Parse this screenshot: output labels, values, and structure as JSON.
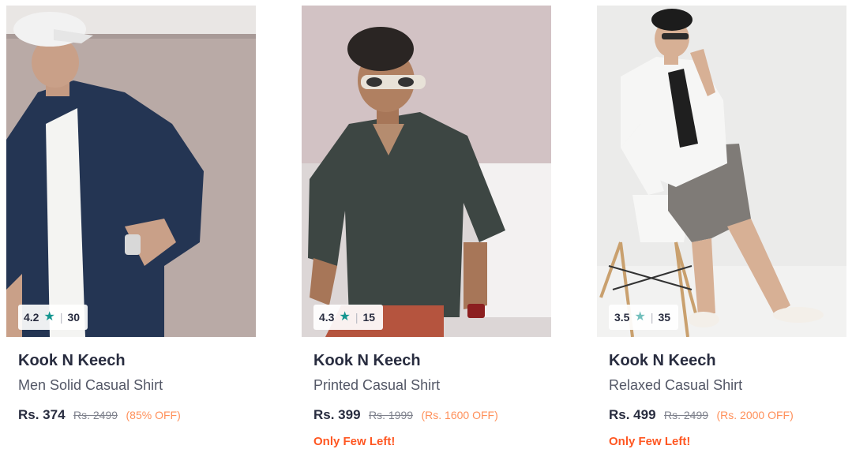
{
  "products": [
    {
      "rating": "4.2",
      "rating_count": "30",
      "brand": "Kook N Keech",
      "name": "Men Solid Casual Shirt",
      "price": "Rs. 374",
      "mrp": "Rs. 2499",
      "discount": "(85% OFF)",
      "stock_note": "",
      "image_desc_icon": "model-photo-navy-shirt"
    },
    {
      "rating": "4.3",
      "rating_count": "15",
      "brand": "Kook N Keech",
      "name": "Printed Casual Shirt",
      "price": "Rs. 399",
      "mrp": "Rs. 1999",
      "discount": "(Rs. 1600 OFF)",
      "stock_note": "Only Few Left!",
      "image_desc_icon": "model-photo-grey-printed-shirt"
    },
    {
      "rating": "3.5",
      "rating_count": "35",
      "brand": "Kook N Keech",
      "name": "Relaxed Casual Shirt",
      "price": "Rs. 499",
      "mrp": "Rs. 2499",
      "discount": "(Rs. 2000 OFF)",
      "stock_note": "Only Few Left!",
      "image_desc_icon": "model-photo-white-shirt"
    }
  ],
  "colors": {
    "star_dark": "#14958f",
    "star_light": "#72bfbc",
    "discount": "#ff905a",
    "stock_note": "#ff5722"
  }
}
